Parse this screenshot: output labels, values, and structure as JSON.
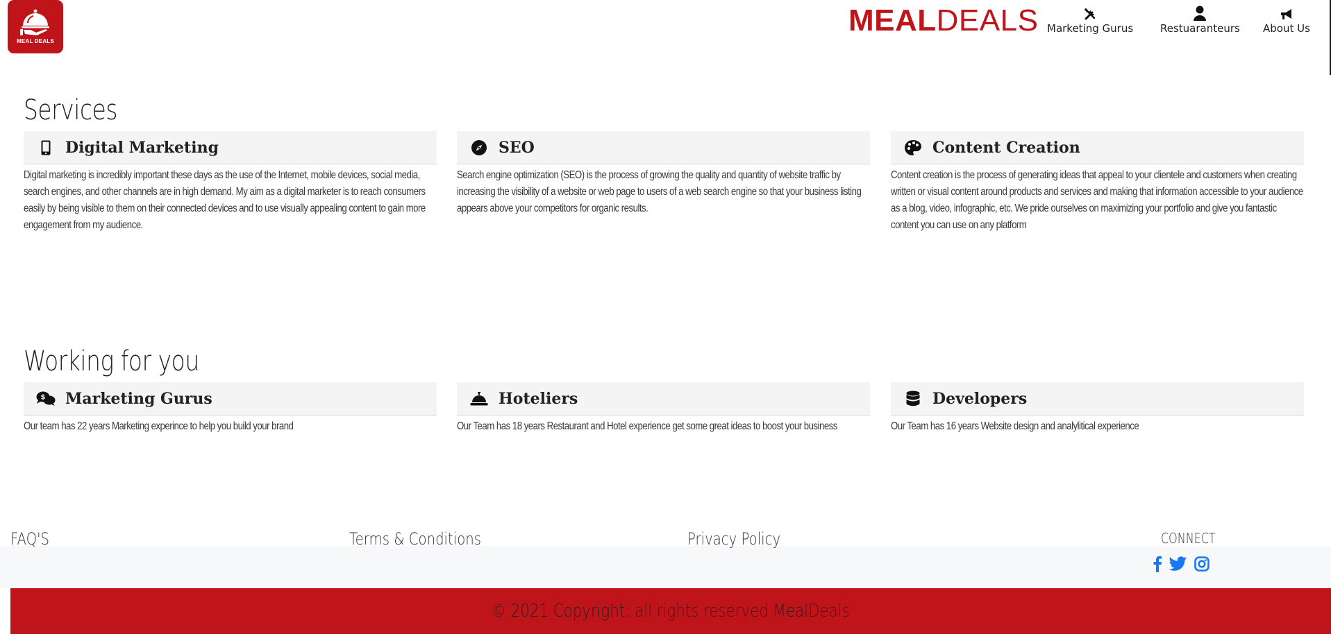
{
  "logo": {
    "text": "MEAL DEALS"
  },
  "brand": {
    "part1": "MEAL",
    "part2": "DEALS",
    "color": "#c0141b"
  },
  "nav": [
    {
      "label": "Marketing Gurus",
      "icon": "tools-icon"
    },
    {
      "label": "Restuaranteurs",
      "icon": "user-icon"
    },
    {
      "label": "About Us",
      "icon": "bullhorn-icon"
    }
  ],
  "services": {
    "title": "Services",
    "cards": [
      {
        "title": "Digital Marketing",
        "icon": "mobile-icon",
        "text": "Digital marketing is incredibly important these days as the use of the Internet, mobile devices, social media, search engines, and other channels are in high demand. My aim as a digital marketer is to reach consumers easily by being visible to them on their connected devices and to use visually appealing content to gain more engagement from my audience."
      },
      {
        "title": "SEO",
        "icon": "compass-icon",
        "text": "Search engine optimization (SEO) is the process of growing the quality and quantity of website traffic by increasing the visibility of a website or web page to users of a web search engine so that your business listing appears above your competitors for organic results."
      },
      {
        "title": "Content Creation",
        "icon": "palette-icon",
        "text": "Content creation is the process of generating ideas that appeal to your clientele and customers when creating written or visual content around products and services and making that information accessible to your audience as a blog, video, infographic, etc. We pride ourselves on maximizing your portfolio and give you fantastic content you can use on any platform"
      }
    ]
  },
  "working": {
    "title": "Working for you",
    "cards": [
      {
        "title": "Marketing Gurus",
        "icon": "comments-dollar-icon",
        "text": "Our team has 22 years Marketing experince to help you build your brand"
      },
      {
        "title": "Hoteliers",
        "icon": "concierge-bell-icon",
        "text": "Our Team has 18 years Restaurant and Hotel experience get some great ideas to boost your business"
      },
      {
        "title": "Developers",
        "icon": "database-icon",
        "text": "Our Team has 16 years Website design and analylitical experience"
      }
    ]
  },
  "footer": {
    "links": [
      "FAQ'S",
      "Terms & Conditions",
      "Privacy Policy"
    ],
    "connect": "CONNECT",
    "social": [
      "facebook-icon",
      "twitter-icon",
      "instagram-icon"
    ],
    "social_color": "#1877f2",
    "copyright": {
      "prefix": "© 2021 Copyright:",
      "middle": " all rights reserved ",
      "meal": "Meal",
      "deals": "Deals"
    },
    "bar_color": "#c0141b"
  }
}
